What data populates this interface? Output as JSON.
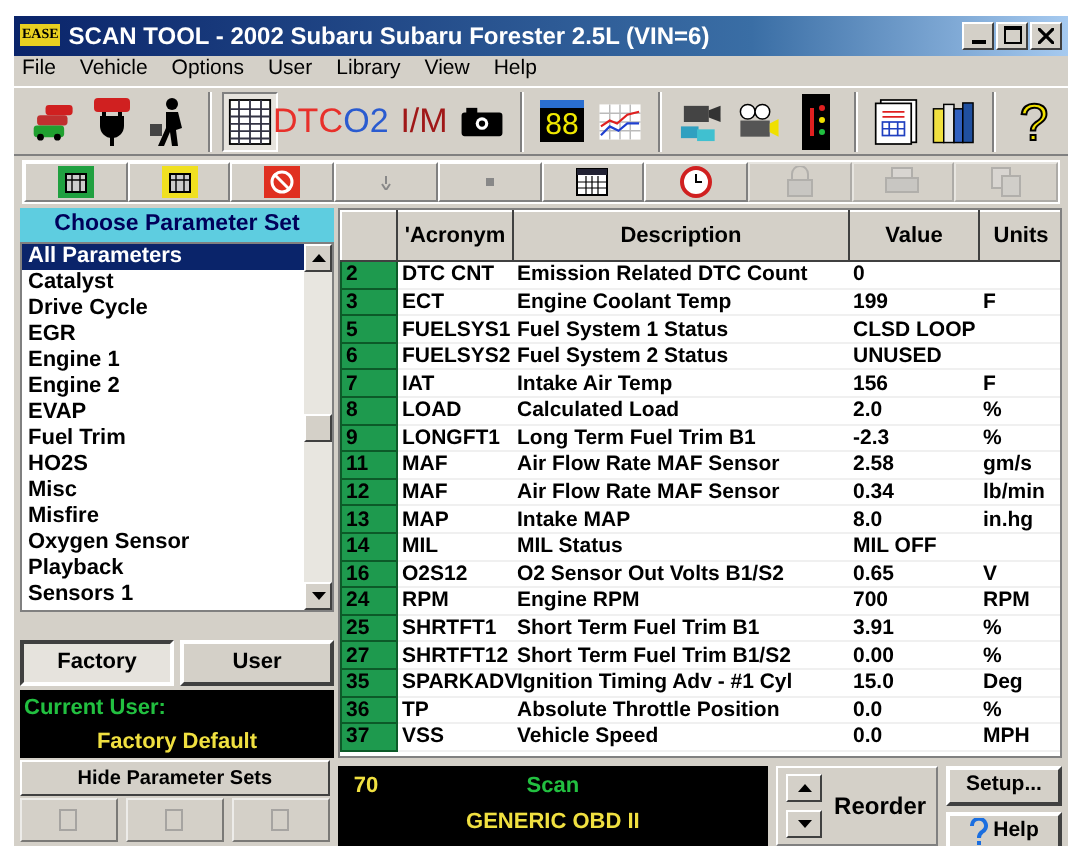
{
  "window": {
    "title": "SCAN TOOL - 2002 Subaru Subaru Forester 2.5L (VIN=6)",
    "logo": "EASE"
  },
  "menu": [
    "File",
    "Vehicle",
    "Options",
    "User",
    "Library",
    "View",
    "Help"
  ],
  "toolbar": [
    {
      "kind": "icon",
      "pressed": false
    },
    {
      "kind": "icon",
      "pressed": false
    },
    {
      "kind": "icon",
      "pressed": false
    },
    {
      "kind": "separator"
    },
    {
      "kind": "icon",
      "pressed": true
    },
    {
      "kind": "text",
      "label": "DTC",
      "color": "#e8302a",
      "pressed": false
    },
    {
      "kind": "text",
      "label": "O2",
      "color": "#2a5bd0",
      "pressed": false
    },
    {
      "kind": "text",
      "label": "I/M",
      "color": "#a01818",
      "pressed": false
    },
    {
      "kind": "icon",
      "pressed": false
    },
    {
      "kind": "separator"
    },
    {
      "kind": "display",
      "label": "88",
      "pressed": false
    },
    {
      "kind": "icon",
      "pressed": false
    },
    {
      "kind": "separator"
    },
    {
      "kind": "icon",
      "pressed": false
    },
    {
      "kind": "icon",
      "pressed": false
    },
    {
      "kind": "icon",
      "pressed": false
    },
    {
      "kind": "separator"
    },
    {
      "kind": "icon",
      "pressed": false
    },
    {
      "kind": "icon",
      "pressed": false
    },
    {
      "kind": "separator"
    },
    {
      "kind": "glyph",
      "label": "?",
      "pressed": false
    }
  ],
  "toolbar2": [
    {
      "disabled": false
    },
    {
      "disabled": false
    },
    {
      "disabled": false
    },
    {
      "disabled": false
    },
    {
      "disabled": false
    },
    {
      "disabled": false
    },
    {
      "disabled": false
    },
    {
      "disabled": true
    },
    {
      "disabled": true
    },
    {
      "disabled": true
    }
  ],
  "parameter_sets": {
    "title": "Choose Parameter Set",
    "items": [
      {
        "label": "All Parameters",
        "selected": true
      },
      {
        "label": "Catalyst",
        "selected": false
      },
      {
        "label": "Drive Cycle",
        "selected": false
      },
      {
        "label": "EGR",
        "selected": false
      },
      {
        "label": "Engine 1",
        "selected": false
      },
      {
        "label": "Engine 2",
        "selected": false
      },
      {
        "label": "EVAP",
        "selected": false
      },
      {
        "label": "Fuel Trim",
        "selected": false
      },
      {
        "label": "HO2S",
        "selected": false
      },
      {
        "label": "Misc",
        "selected": false
      },
      {
        "label": "Misfire",
        "selected": false
      },
      {
        "label": "Oxygen Sensor",
        "selected": false
      },
      {
        "label": "Playback",
        "selected": false
      },
      {
        "label": "Sensors 1",
        "selected": false
      }
    ],
    "tabs": [
      {
        "label": "Factory",
        "selected": true
      },
      {
        "label": "User",
        "selected": false
      }
    ],
    "current_user_label": "Current User:",
    "current_user": "Factory Default",
    "hide_button": "Hide Parameter Sets"
  },
  "table": {
    "columns": [
      "'Acronym",
      "Description",
      "Value",
      "Units"
    ],
    "rows": [
      {
        "num": "2",
        "acronym": "DTC CNT",
        "description": "Emission Related DTC Count",
        "value": "0",
        "units": ""
      },
      {
        "num": "3",
        "acronym": "ECT",
        "description": "Engine Coolant Temp",
        "value": "199",
        "units": "F"
      },
      {
        "num": "5",
        "acronym": "FUELSYS1",
        "description": "Fuel System 1 Status",
        "value": "CLSD LOOP",
        "units": ""
      },
      {
        "num": "6",
        "acronym": "FUELSYS2",
        "description": "Fuel System 2 Status",
        "value": "UNUSED",
        "units": ""
      },
      {
        "num": "7",
        "acronym": "IAT",
        "description": "Intake Air Temp",
        "value": "156",
        "units": "F"
      },
      {
        "num": "8",
        "acronym": "LOAD",
        "description": "Calculated Load",
        "value": "2.0",
        "units": "%"
      },
      {
        "num": "9",
        "acronym": "LONGFT1",
        "description": "Long Term Fuel Trim B1",
        "value": "-2.3",
        "units": "%"
      },
      {
        "num": "11",
        "acronym": "MAF",
        "description": "Air Flow Rate MAF Sensor",
        "value": "2.58",
        "units": "gm/s"
      },
      {
        "num": "12",
        "acronym": "MAF",
        "description": "Air Flow Rate MAF Sensor",
        "value": "0.34",
        "units": "lb/min"
      },
      {
        "num": "13",
        "acronym": "MAP",
        "description": "Intake MAP",
        "value": "8.0",
        "units": "in.hg"
      },
      {
        "num": "14",
        "acronym": "MIL",
        "description": "MIL Status",
        "value": "MIL OFF",
        "units": ""
      },
      {
        "num": "16",
        "acronym": "O2S12",
        "description": "O2 Sensor Out Volts B1/S2",
        "value": "0.65",
        "units": "V"
      },
      {
        "num": "24",
        "acronym": "RPM",
        "description": "Engine RPM",
        "value": "700",
        "units": "RPM"
      },
      {
        "num": "25",
        "acronym": "SHRTFT1",
        "description": "Short Term Fuel Trim B1",
        "value": "3.91",
        "units": "%"
      },
      {
        "num": "27",
        "acronym": "SHRTFT12",
        "description": "Short Term Fuel Trim B1/S2",
        "value": "0.00",
        "units": "%"
      },
      {
        "num": "35",
        "acronym": "SPARKADV",
        "description": "Ignition Timing Adv - #1 Cyl",
        "value": "15.0",
        "units": "Deg"
      },
      {
        "num": "36",
        "acronym": "TP",
        "description": "Absolute Throttle Position",
        "value": "0.0",
        "units": "%"
      },
      {
        "num": "37",
        "acronym": "VSS",
        "description": "Vehicle Speed",
        "value": "0.0",
        "units": "MPH"
      }
    ]
  },
  "status": {
    "count": "70",
    "mode": "Scan",
    "protocol": "GENERIC OBD II"
  },
  "reorder": "Reorder",
  "setup": "Setup...",
  "help": "Help"
}
